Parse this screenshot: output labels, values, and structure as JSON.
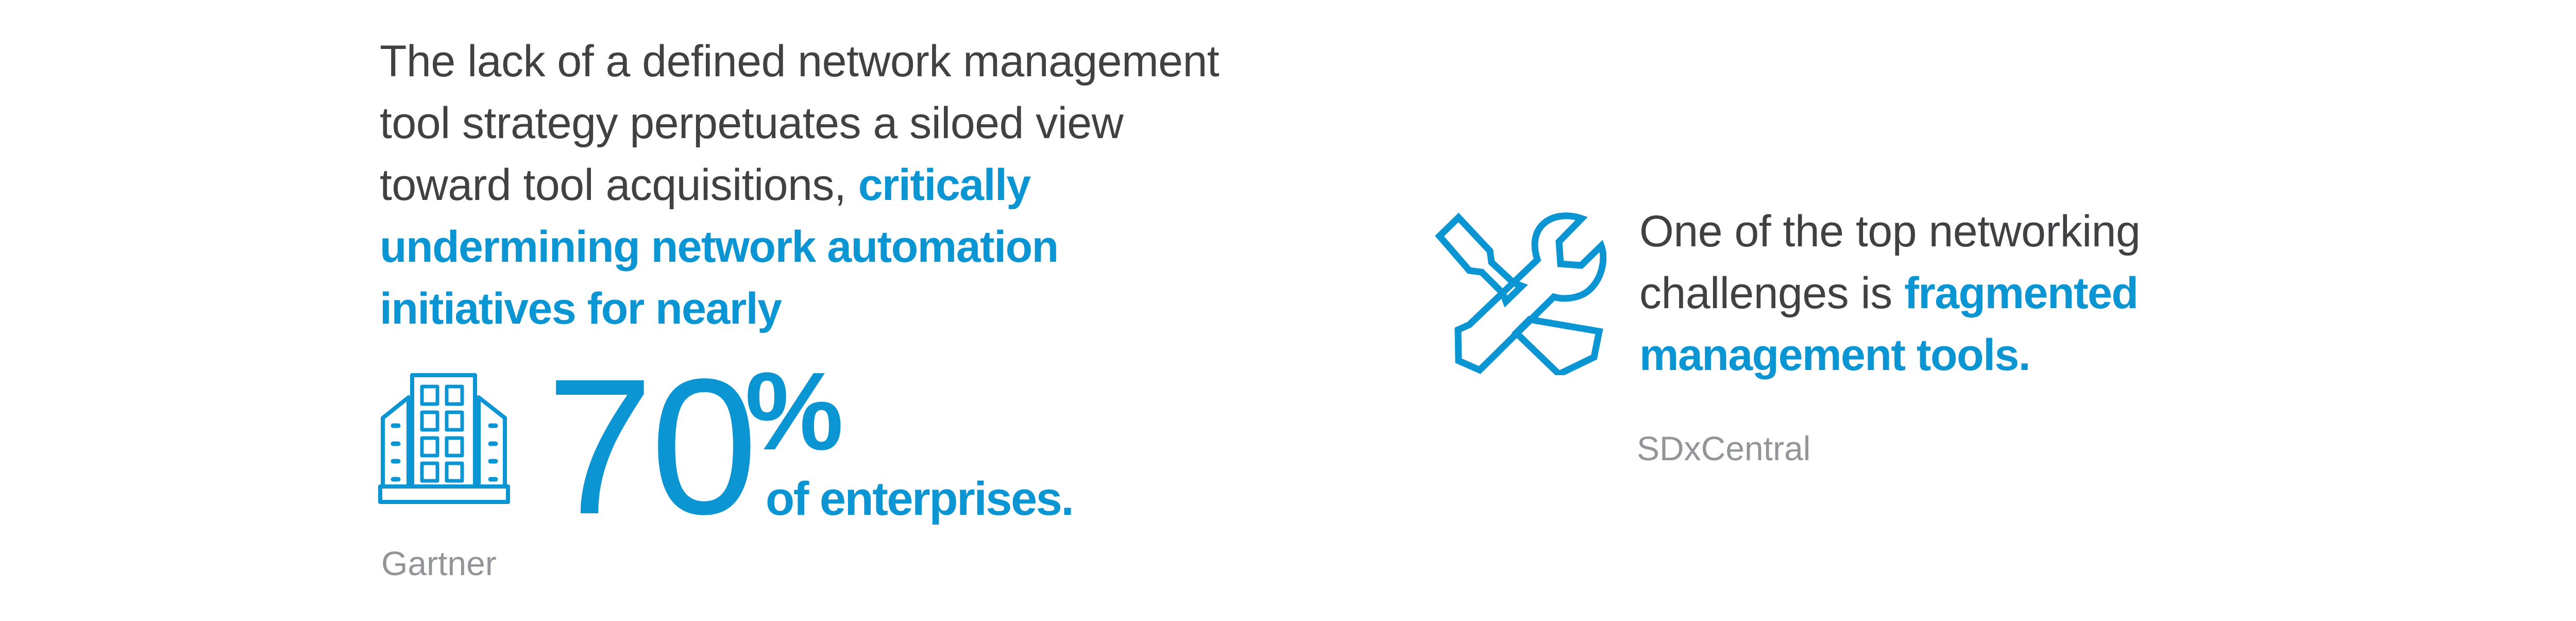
{
  "colors": {
    "accent": "#0b95d3",
    "body_text": "#414042",
    "source_text": "#939598"
  },
  "left_panel": {
    "lines": [
      [
        {
          "text": "The lack of a defined network management",
          "highlight": false
        }
      ],
      [
        {
          "text": "tool strategy perpetuates a siloed view",
          "highlight": false
        }
      ],
      [
        {
          "text": "toward tool acquisitions, ",
          "highlight": false
        },
        {
          "text": "critically",
          "highlight": true
        }
      ],
      [
        {
          "text": "undermining network automation",
          "highlight": true
        }
      ],
      [
        {
          "text": "initiatives for nearly",
          "highlight": true
        }
      ]
    ],
    "icon": "building-icon",
    "stat": {
      "number": "70",
      "unit": "%",
      "caption": "of enterprises.",
      "value_percent": 70
    },
    "source": "Gartner"
  },
  "right_panel": {
    "icon": "tools-icon",
    "lines": [
      [
        {
          "text": "One of the top networking",
          "highlight": false
        }
      ],
      [
        {
          "text": "challenges is ",
          "highlight": false
        },
        {
          "text": "fragmented",
          "highlight": true
        }
      ],
      [
        {
          "text": "management tools.",
          "highlight": true
        }
      ]
    ],
    "source": "SDxCentral"
  }
}
